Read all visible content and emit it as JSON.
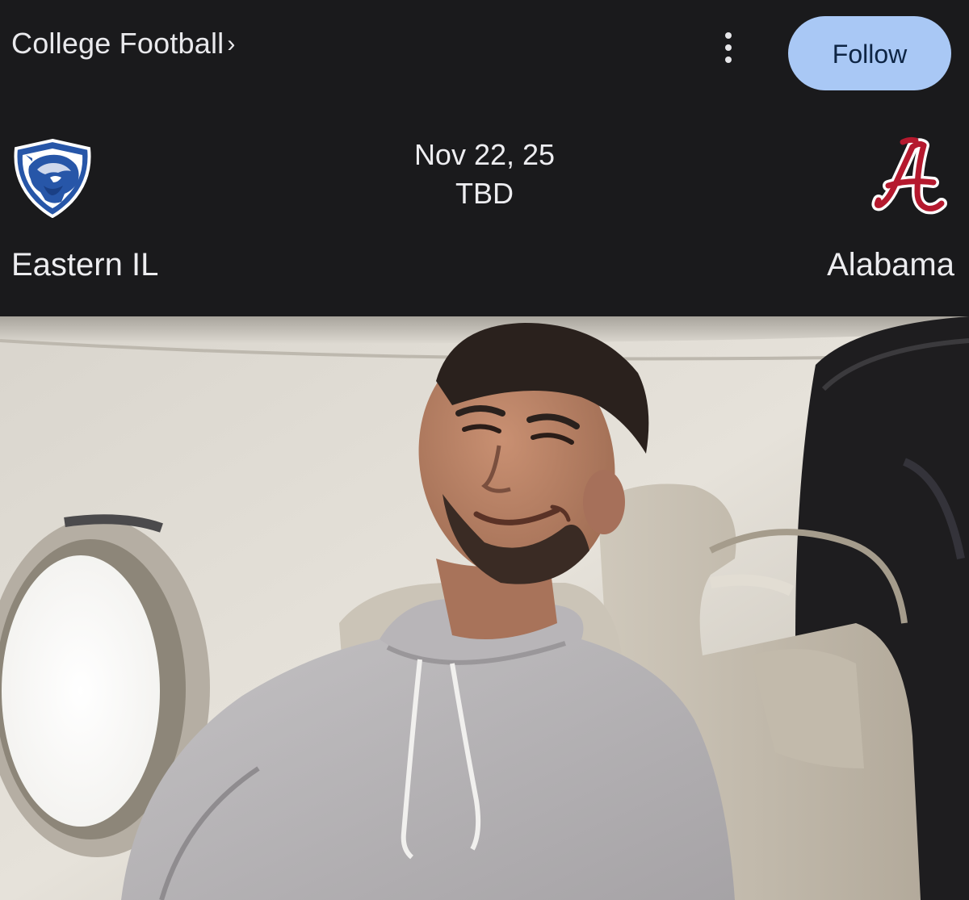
{
  "header": {
    "league_label": "College Football",
    "league_chevron": "›",
    "more_icon": "more-vert-icon",
    "follow_label": "Follow",
    "accent_color": "#a9c8f5"
  },
  "matchup": {
    "date": "Nov 22, 25",
    "time": "TBD",
    "home_team": {
      "name": "Eastern IL",
      "logo_icon": "panther-shield-logo",
      "color": "#2756a8"
    },
    "away_team": {
      "name": "Alabama",
      "logo_icon": "script-a-logo",
      "color": "#b5192e"
    }
  }
}
